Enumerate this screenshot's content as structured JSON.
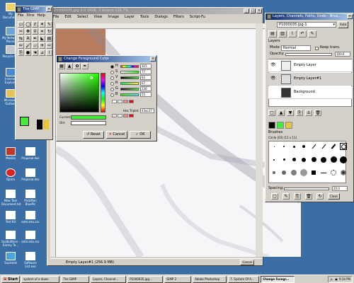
{
  "desktop_icons": [
    {
      "label": "My Documents",
      "icon": "folder-icon"
    },
    {
      "label": "My Network Places",
      "icon": "network-icon"
    },
    {
      "label": "Recycle Bin",
      "icon": "recycle-bin-icon"
    },
    {
      "label": "Internet Explorer",
      "icon": "browser-icon"
    },
    {
      "label": "Microsoft Outlook",
      "icon": "mail-icon"
    },
    {
      "label": "Mozilla",
      "icon": "mozilla-icon"
    },
    {
      "label": "Opera",
      "icon": "opera-icon"
    },
    {
      "label": "New Text Document.txt",
      "icon": "text-file-icon"
    },
    {
      "label": "Test Kit",
      "icon": "text-file-icon"
    },
    {
      "label": "toolbuttons - Emmy Te...",
      "icon": "text-file-icon"
    },
    {
      "label": "Soulseek",
      "icon": "soulseek-icon"
    },
    {
      "label": "Proposal.doc",
      "icon": "word-doc-icon"
    },
    {
      "label": "Proposal.doc",
      "icon": "word-doc-icon"
    },
    {
      "label": "PackMan BluePic",
      "icon": "text-file-icon"
    },
    {
      "label": "ante.edu.ssc",
      "icon": "text-file-icon"
    },
    {
      "label": "ante.edu.ssc",
      "icon": "text-file-icon"
    },
    {
      "label": "Software List.exe",
      "icon": "text-file-icon"
    }
  ],
  "image_window": {
    "title": "P1000035.jpg-3.0 (RGB, 3 layers) 116.7%",
    "menus": [
      "File",
      "Edit",
      "Select",
      "View",
      "Image",
      "Layer",
      "Tools",
      "Dialogs",
      "Filters",
      "Script-Fu"
    ],
    "status": "Empty Layer#1 (256.9 MB)",
    "status_button": "Cancel"
  },
  "toolbox": {
    "title": "The GIMP",
    "menus": [
      "File",
      "Xtns",
      "Help"
    ]
  },
  "color_dialog": {
    "title": "Change Foreground Color",
    "channels": [
      {
        "key": "H",
        "value": "115"
      },
      {
        "key": "S",
        "value": "77"
      },
      {
        "key": "V",
        "value": "93"
      },
      {
        "key": "R",
        "value": "67"
      },
      {
        "key": "G",
        "value": "236"
      },
      {
        "key": "B",
        "value": "55"
      }
    ],
    "hex_label": "Hex Triplet:",
    "hex_value": "43ec37",
    "current_label": "Current:",
    "old_label": "Old:",
    "current_color": "#43ec37",
    "old_color": "#ffffff",
    "buttons": {
      "reset": "Reset",
      "cancel": "Cancel",
      "ok": "OK"
    },
    "swatches": [
      "#ffffff",
      "#e8e8e8",
      "#ff8080",
      "#ff0000",
      "#ffd0d0",
      "#f0f0f0",
      "#ff8080",
      "#ff0000"
    ]
  },
  "layers_dialog": {
    "title": "Layers, Channels, Paths, Undo - Brus...",
    "image_select": "P1000035.jpg-1",
    "auto_button": "Auto",
    "tab_label": "Layers",
    "mode_label": "Mode:",
    "mode_value": "Normal",
    "keep_trans_label": "Keep trans.",
    "opacity_label": "Opacity:",
    "opacity_value": "100.0",
    "layers": [
      {
        "name": "Empty Layer",
        "selected": false
      },
      {
        "name": "Empty Layer#1",
        "selected": true
      },
      {
        "name": "Background",
        "selected": false
      }
    ],
    "brushes_label": "Brushes",
    "brush_name": "Circle (03) (11 x 11)",
    "spacing_label": "Spacing:",
    "spacing_value": "20.0",
    "close_label": "Close"
  },
  "taskbar": {
    "start": "Start",
    "buttons": [
      {
        "label": "system of a down",
        "active": false
      },
      {
        "label": "The GIMP",
        "active": false
      },
      {
        "label": "Layers, Channel...",
        "active": false
      },
      {
        "label": "P1000035.jpg...",
        "active": false
      },
      {
        "label": "GIMP 2",
        "active": false
      },
      {
        "label": "Adobe Photoshop",
        "active": false
      },
      {
        "label": "7. System Of A...",
        "active": false
      },
      {
        "label": "Change Foregr...",
        "active": true
      }
    ],
    "clock": "9:34 PM"
  }
}
